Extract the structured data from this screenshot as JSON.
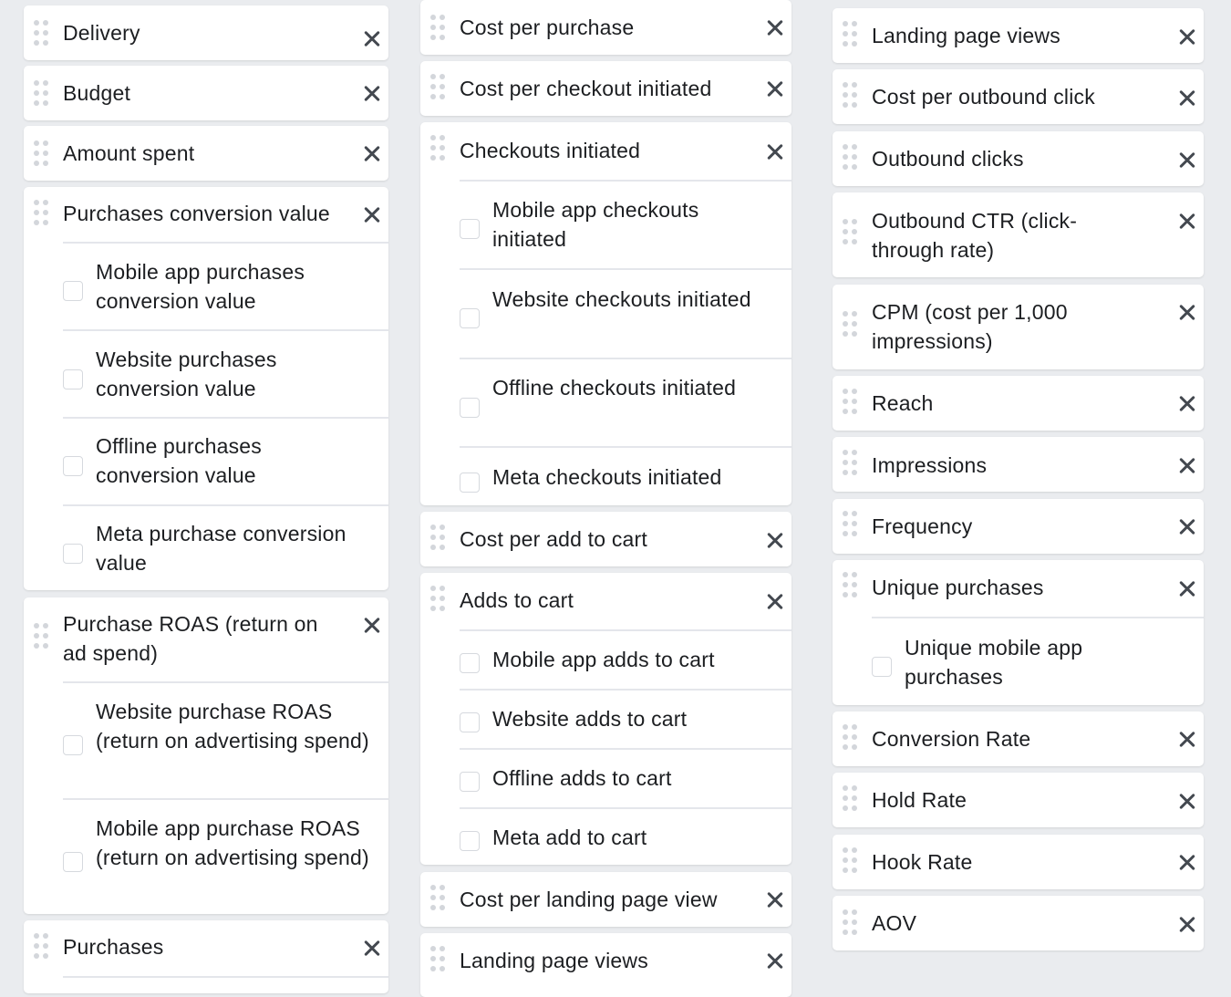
{
  "columns": [
    {
      "items": [
        {
          "label": "Delivery"
        },
        {
          "label": "Budget"
        },
        {
          "label": "Amount spent"
        },
        {
          "label": "Purchases conversion value",
          "sub": [
            "Mobile app purchases conversion value",
            "Website purchases conversion value",
            "Offline purchases conversion value",
            "Meta purchase conversion value"
          ]
        },
        {
          "label": "Purchase ROAS (return on ad spend)",
          "sub": [
            "Website purchase ROAS (return on advertising spend)",
            "Mobile app purchase ROAS (return on advertising spend)"
          ]
        },
        {
          "label": "Purchases"
        }
      ]
    },
    {
      "items": [
        {
          "label": "Cost per purchase"
        },
        {
          "label": "Cost per checkout initiated"
        },
        {
          "label": "Checkouts initiated",
          "sub": [
            "Mobile app checkouts initiated",
            "Website checkouts initiated",
            "Offline checkouts initiated",
            "Meta checkouts initiated"
          ]
        },
        {
          "label": "Cost per add to cart"
        },
        {
          "label": "Adds to cart",
          "sub": [
            "Mobile app adds to cart",
            "Website adds to cart",
            "Offline adds to cart",
            "Meta add to cart"
          ]
        },
        {
          "label": "Cost per landing page view"
        },
        {
          "label": "Landing page views"
        }
      ]
    },
    {
      "items": [
        {
          "label": "Landing page views"
        },
        {
          "label": "Cost per outbound click"
        },
        {
          "label": "Outbound clicks"
        },
        {
          "label": "Outbound CTR (click-through rate)"
        },
        {
          "label": "CPM (cost per 1,000 impressions)"
        },
        {
          "label": "Reach"
        },
        {
          "label": "Impressions"
        },
        {
          "label": "Frequency"
        },
        {
          "label": "Unique purchases",
          "sub": [
            "Unique mobile app purchases"
          ]
        },
        {
          "label": "Conversion Rate"
        },
        {
          "label": "Hold Rate"
        },
        {
          "label": "Hook Rate"
        },
        {
          "label": "AOV"
        }
      ]
    }
  ]
}
